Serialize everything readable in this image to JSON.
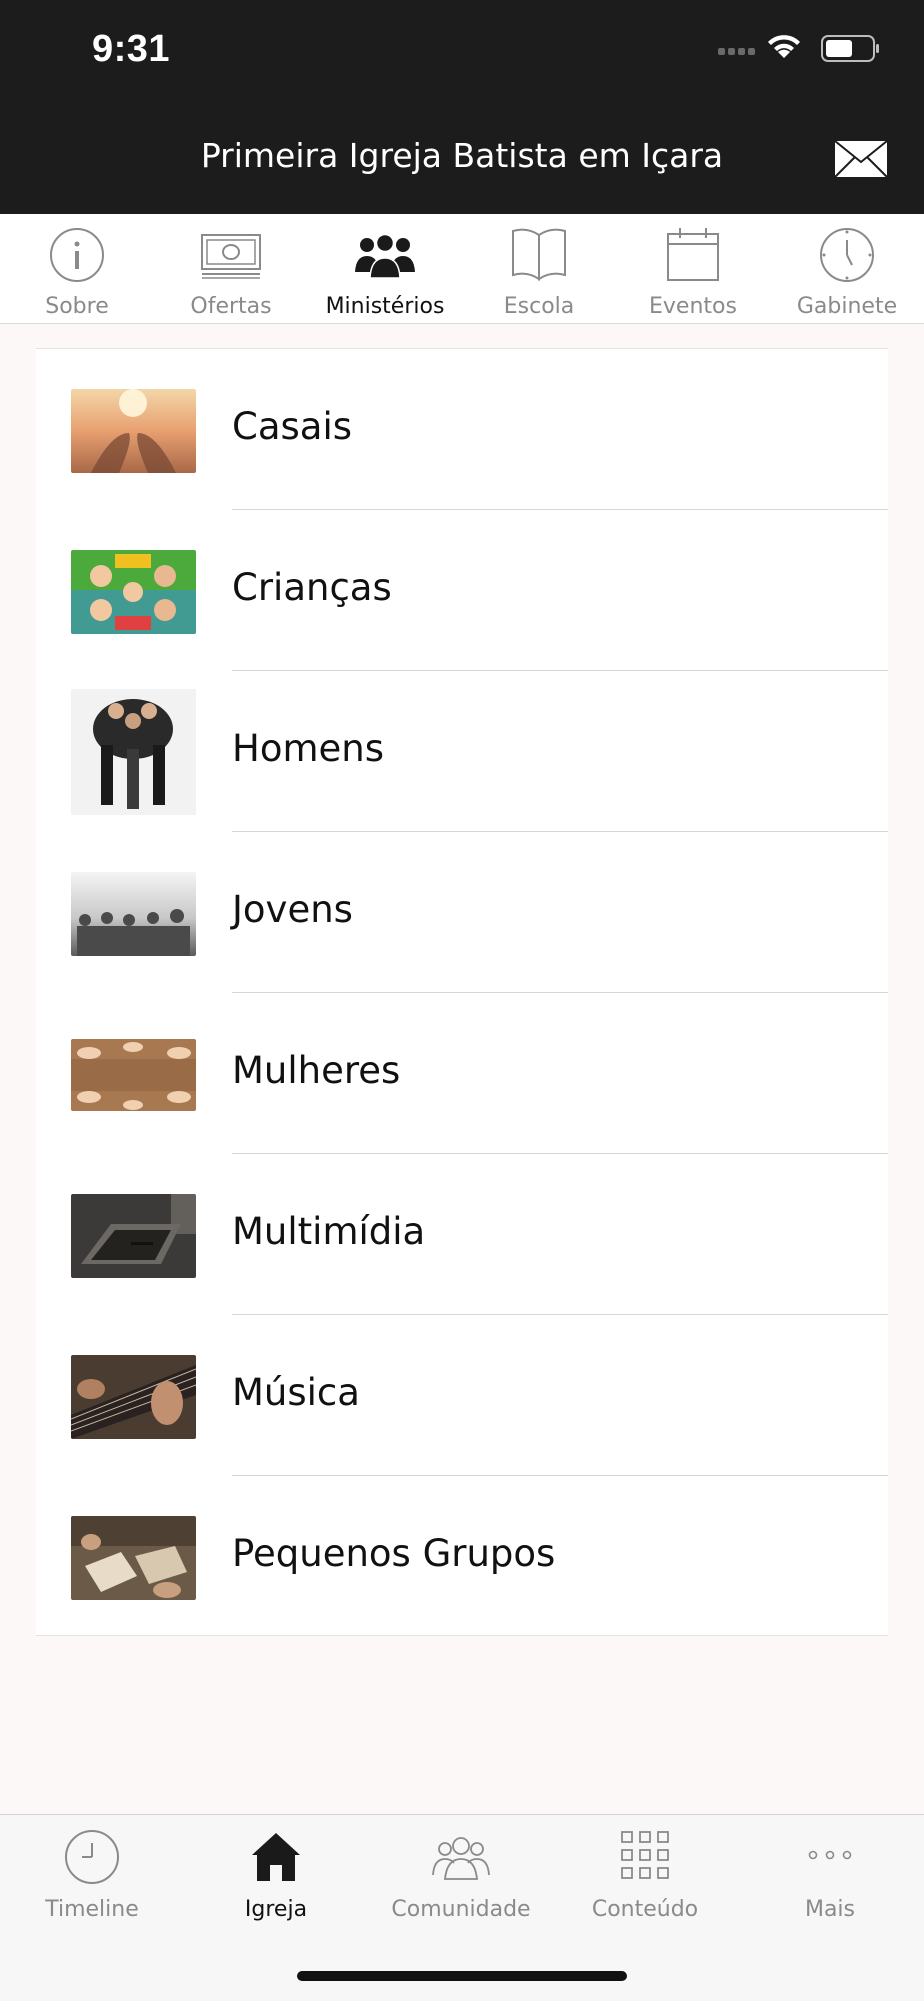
{
  "status_bar": {
    "time": "9:31"
  },
  "header": {
    "title": "Primeira Igreja Batista em Içara",
    "mail_icon": "envelope-icon"
  },
  "top_tabs": [
    {
      "label": "Sobre",
      "icon": "info-icon",
      "active": false
    },
    {
      "label": "Ofertas",
      "icon": "money-icon",
      "active": false
    },
    {
      "label": "Ministérios",
      "icon": "people-group-icon",
      "active": true
    },
    {
      "label": "Escola",
      "icon": "book-icon",
      "active": false
    },
    {
      "label": "Eventos",
      "icon": "calendar-icon",
      "active": false
    },
    {
      "label": "Gabinete",
      "icon": "clock-icon",
      "active": false
    }
  ],
  "ministries": [
    {
      "label": "Casais",
      "thumb_colors": [
        "#e8a070",
        "#a86848",
        "#f3d6a8"
      ]
    },
    {
      "label": "Crianças",
      "thumb_colors": [
        "#4caa3c",
        "#f0c020",
        "#3a8ed8"
      ]
    },
    {
      "label": "Homens",
      "thumb_colors": [
        "#f2f2f2",
        "#2a2a2a",
        "#6a6a6a"
      ]
    },
    {
      "label": "Jovens",
      "thumb_colors": [
        "#d8d8d8",
        "#5a5a5a",
        "#9a9a9a"
      ]
    },
    {
      "label": "Mulheres",
      "thumb_colors": [
        "#a87850",
        "#6c4c34",
        "#e8c8a8"
      ]
    },
    {
      "label": "Multimídia",
      "thumb_colors": [
        "#3c3a38",
        "#6c6864",
        "#242220"
      ]
    },
    {
      "label": "Música",
      "thumb_colors": [
        "#4a3c30",
        "#c09070",
        "#2a2220"
      ]
    },
    {
      "label": "Pequenos Grupos",
      "thumb_colors": [
        "#6c5a48",
        "#d8c8b0",
        "#3a3028"
      ]
    }
  ],
  "bottom_tabs": [
    {
      "label": "Timeline",
      "icon": "clock-icon",
      "active": false
    },
    {
      "label": "Igreja",
      "icon": "home-icon",
      "active": true
    },
    {
      "label": "Comunidade",
      "icon": "community-icon",
      "active": false
    },
    {
      "label": "Conteúdo",
      "icon": "grid-icon",
      "active": false
    },
    {
      "label": "Mais",
      "icon": "more-icon",
      "active": false
    }
  ]
}
